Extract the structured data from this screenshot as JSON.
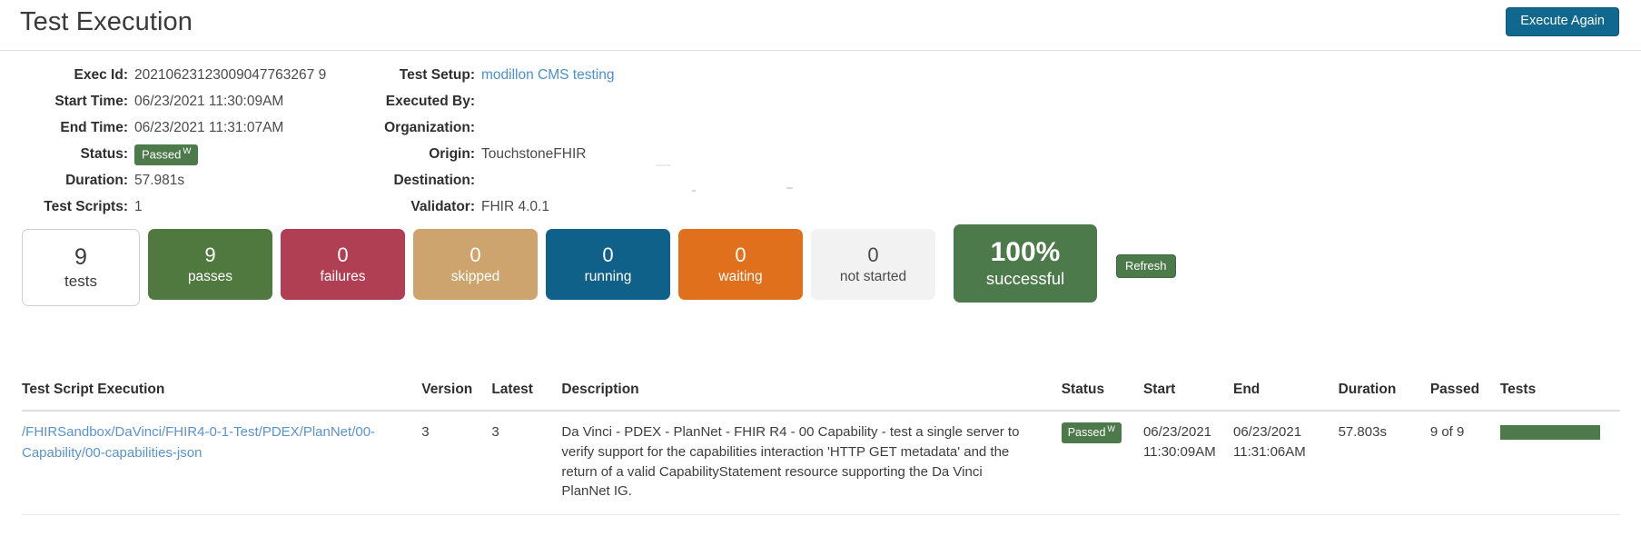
{
  "header": {
    "title": "Test Execution",
    "execute_again_label": "Execute Again"
  },
  "meta": {
    "left": [
      {
        "label": "Exec Id:",
        "value": "20210623123009047763267 9"
      },
      {
        "label": "Start Time:",
        "value": "06/23/2021 11:30:09AM"
      },
      {
        "label": "End Time:",
        "value": "06/23/2021 11:31:07AM"
      },
      {
        "label": "Status:",
        "value": ""
      },
      {
        "label": "Duration:",
        "value": "57.981s"
      },
      {
        "label": "Test Scripts:",
        "value": "1"
      }
    ],
    "exec_id": "20210623123009047763267 9",
    "status_badge": {
      "text": "Passed",
      "sup": "W",
      "color": "#4c7a4a"
    },
    "right": [
      {
        "label": "Test Setup:",
        "value": "modillon CMS testing",
        "link": true
      },
      {
        "label": "Executed By:",
        "value": ""
      },
      {
        "label": "Organization:",
        "value": ""
      },
      {
        "label": "Origin:",
        "value": "TouchstoneFHIR"
      },
      {
        "label": "Destination:",
        "value": ""
      },
      {
        "label": "Validator:",
        "value": "FHIR 4.0.1"
      }
    ]
  },
  "stats": [
    {
      "count": "9",
      "label": "tests",
      "style": "outline",
      "color": "#ffffff"
    },
    {
      "count": "9",
      "label": "passes",
      "style": "filled",
      "color": "#50793f"
    },
    {
      "count": "0",
      "label": "failures",
      "style": "filled",
      "color": "#b03f54"
    },
    {
      "count": "0",
      "label": "skipped",
      "style": "filled",
      "color": "#cda46d"
    },
    {
      "count": "0",
      "label": "running",
      "style": "filled",
      "color": "#0f6189"
    },
    {
      "count": "0",
      "label": "waiting",
      "style": "filled",
      "color": "#e0701b"
    },
    {
      "count": "0",
      "label": "not started",
      "style": "notstarted",
      "color": "#f2f2f2"
    }
  ],
  "success": {
    "percent": "100%",
    "label": "successful",
    "color": "#4c7a4a"
  },
  "refresh_label": "Refresh",
  "table": {
    "headers": [
      "Test Script Execution",
      "Version",
      "Latest",
      "Description",
      "Status",
      "Start",
      "End",
      "Duration",
      "Passed",
      "Tests"
    ],
    "rows": [
      {
        "script": "/FHIRSandbox/DaVinci/FHIR4-0-1-Test/PDEX/PlanNet/00-Capability/00-capabilities-json",
        "version": "3",
        "latest": "3",
        "description": "Da Vinci - PDEX - PlanNet - FHIR R4 - 00 Capability - test a single server to verify support for the capabilities interaction 'HTTP GET metadata' and the return of a valid CapabilityStatement resource supporting the Da Vinci PlanNet IG.",
        "status": "Passed",
        "status_sup": "W",
        "start_date": "06/23/2021",
        "start_time": "11:30:09AM",
        "end_date": "06/23/2021",
        "end_time": "11:31:06AM",
        "duration": "57.803s",
        "passed": "9 of 9",
        "tests_bar_pct": 100
      }
    ]
  }
}
